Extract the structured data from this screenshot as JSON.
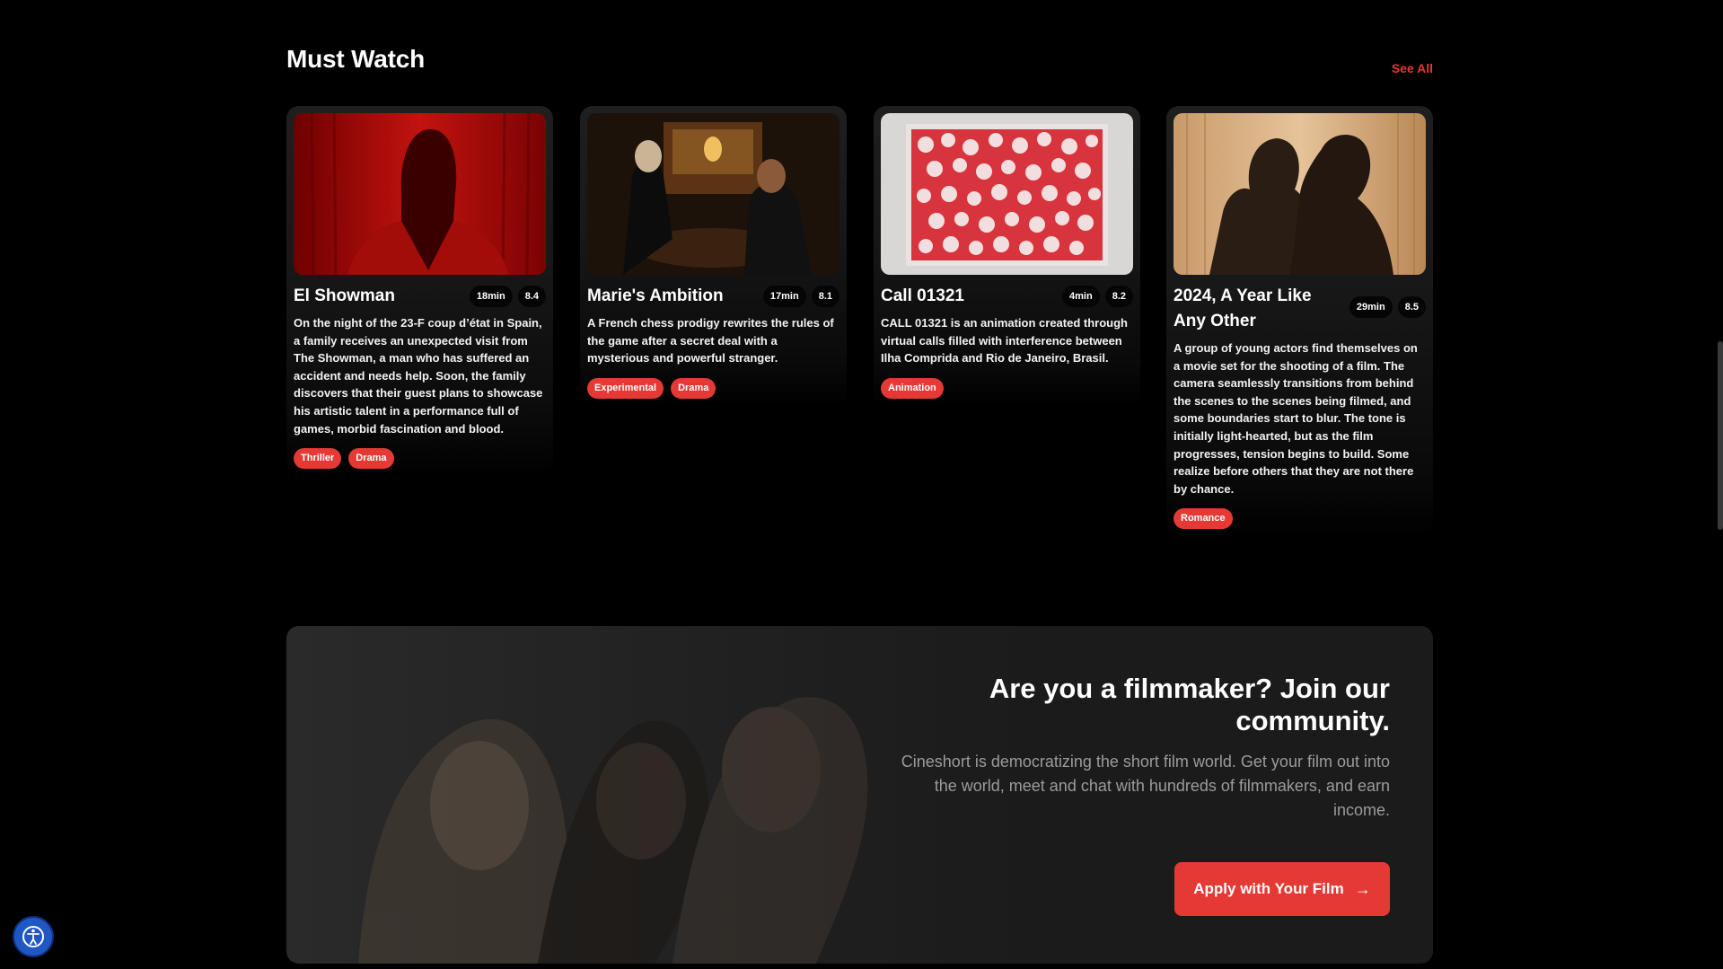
{
  "section": {
    "title": "Must Watch",
    "see_all": "See All"
  },
  "films": [
    {
      "title": "El Showman",
      "duration": "18min",
      "rating": "8.4",
      "description": "On the night of the 23-F coup d’état in Spain, a family receives an unexpected visit from The Showman, a man who has suffered an accident and needs help. Soon, the family discovers that their guest plans to showcase his artistic talent in a performance full of games, morbid fascination and blood.",
      "tags": [
        "Thriller",
        "Drama"
      ]
    },
    {
      "title": "Marie's Ambition",
      "duration": "17min",
      "rating": "8.1",
      "description": "A French chess prodigy rewrites the rules of the game after a secret deal with a mysterious and powerful stranger.",
      "tags": [
        "Experimental",
        "Drama"
      ]
    },
    {
      "title": "Call 01321",
      "duration": "4min",
      "rating": "8.2",
      "description": "CALL 01321 is an animation created through virtual calls filled with interference between Ilha Comprida and Rio de Janeiro, Brasil.",
      "tags": [
        "Animation"
      ]
    },
    {
      "title": "2024, A Year Like Any Other",
      "duration": "29min",
      "rating": "8.5",
      "description": "A group of young actors find themselves on a movie set for the shooting of a film. The camera seamlessly transitions from behind the scenes to the scenes being filmed, and some boundaries start to blur. The tone is initially light-hearted, but as the film progresses, tension begins to build. Some realize before others that they are not there by chance.",
      "tags": [
        "Romance"
      ]
    }
  ],
  "cta": {
    "title": "Are you a filmmaker? Join our community.",
    "subtitle": "Cineshort is democratizing the short film world. Get your film out into the world, meet and chat with hundreds of filmmakers, and earn income.",
    "button_label": "Apply with Your Film",
    "button_icon": "arrow-right-icon"
  },
  "accessibility_widget": {
    "icon": "accessibility-icon"
  },
  "colors": {
    "accent": "#e53935",
    "background": "#000000",
    "card": "#1f1f1f"
  }
}
